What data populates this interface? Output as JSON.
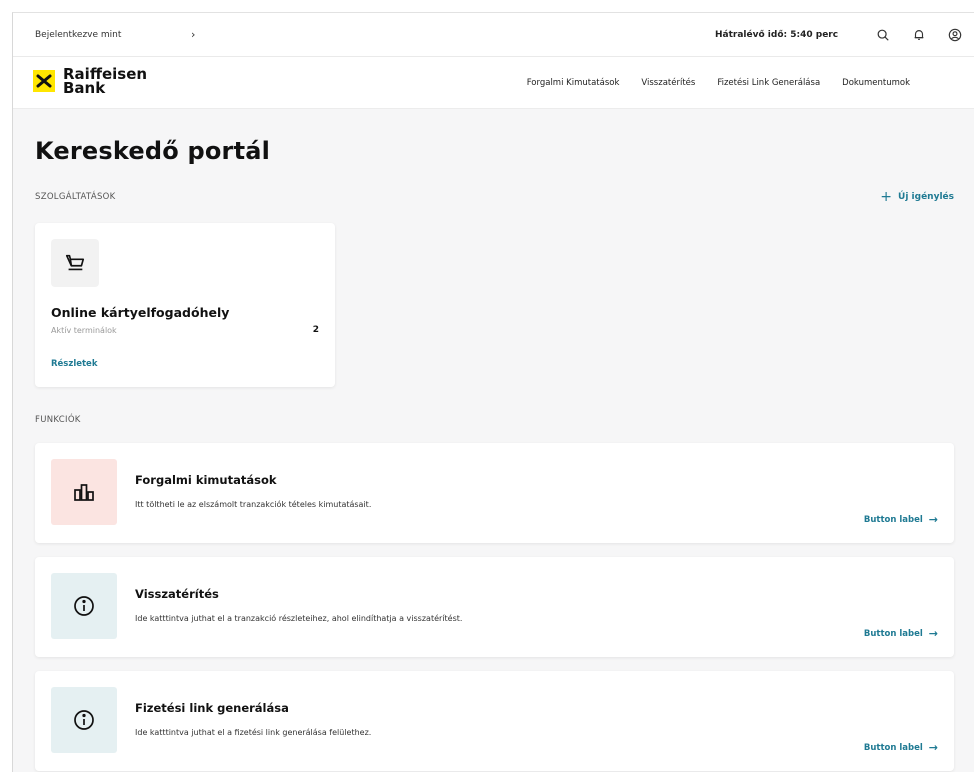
{
  "topbar": {
    "logged_in_label": "Bejelentkezve mint",
    "chevron": "›",
    "session_timer": "Hátralévő idő:  5:40 perc",
    "icons": [
      "search-icon",
      "bell-icon",
      "user-icon"
    ]
  },
  "brand": {
    "name_line1": "Raiffeisen",
    "name_line2": "Bank",
    "accent_color": "#ffe600"
  },
  "nav": {
    "items": [
      "Forgalmi Kimutatások",
      "Visszatérítés",
      "Fizetési Link Generálása",
      "Dokumentumok"
    ]
  },
  "page": {
    "title": "Kereskedő portál"
  },
  "services": {
    "section_label": "SZOLGÁLTATÁSOK",
    "new_request_label": "Új igénylés",
    "card": {
      "title": "Online kártyelfogadóhely",
      "subtitle": "Aktív terminálok",
      "count": "2",
      "link": "Részletek",
      "icon": "cart-icon"
    }
  },
  "functions": {
    "section_label": "FUNKCIÓK",
    "items": [
      {
        "title": "Forgalmi kimutatások",
        "description": "Itt töltheti le az elszámolt tranzakciók tételes kimutatásait.",
        "button": "Button label",
        "icon": "chart-icon",
        "icon_bg": "#fbe4e1"
      },
      {
        "title": "Visszatérítés",
        "description": "Ide katttintva juthat el a tranzakció részleteihez, ahol elindíthatja a visszatérítést.",
        "button": "Button label",
        "icon": "info-icon",
        "icon_bg": "#e5f0f2"
      },
      {
        "title": "Fizetési link generálása",
        "description": "Ide katttintva juthat el a fizetési link generálása felülethez.",
        "button": "Button label",
        "icon": "info-icon",
        "icon_bg": "#e5f0f2"
      }
    ]
  },
  "colors": {
    "link": "#1f7a93",
    "page_bg": "#f6f6f7"
  }
}
